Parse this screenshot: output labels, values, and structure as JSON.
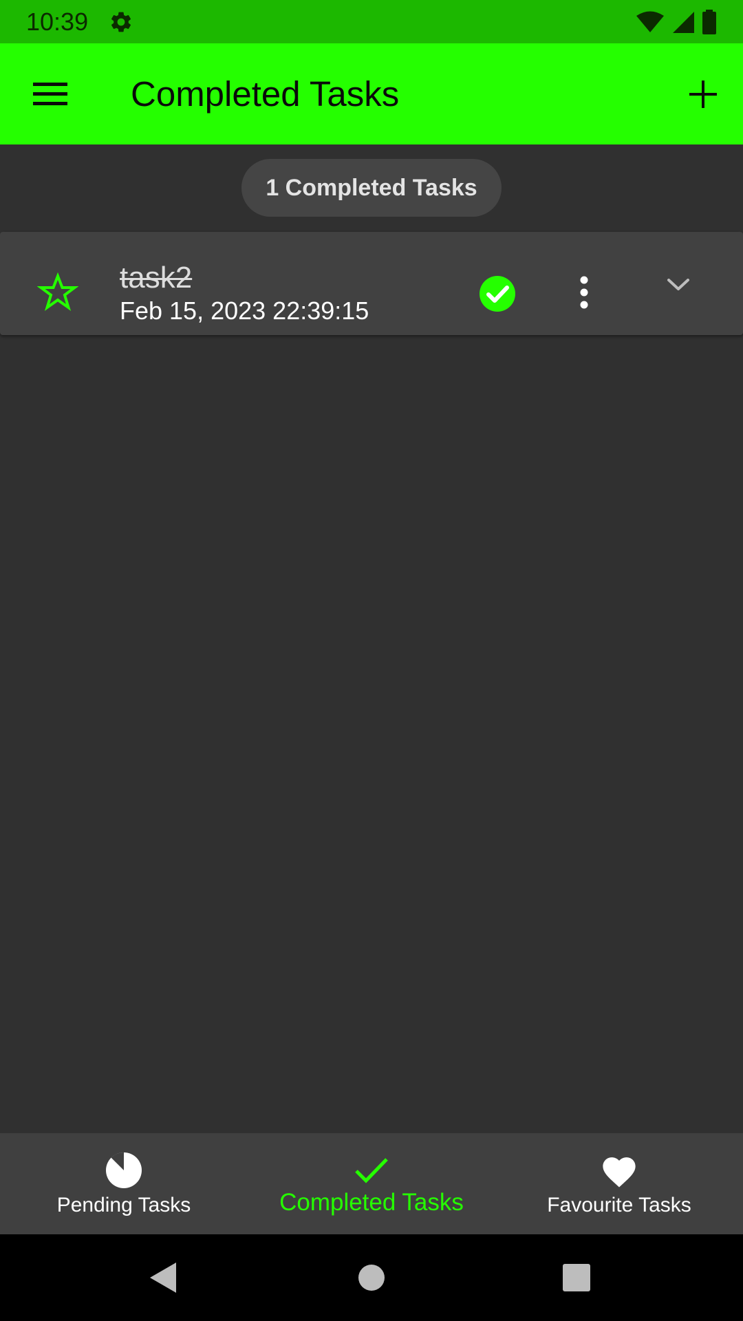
{
  "status_bar": {
    "time": "10:39",
    "icons": [
      "settings-icon",
      "wifi-icon",
      "signal-icon",
      "battery-icon"
    ]
  },
  "app_bar": {
    "title": "Completed Tasks",
    "menu_icon": "menu-icon",
    "add_icon": "add-icon"
  },
  "summary": {
    "count_label": "1 Completed Tasks"
  },
  "tasks": [
    {
      "title": "task2",
      "date": "Feb 15, 2023 22:39:15",
      "favourite": false,
      "completed": true
    }
  ],
  "bottom_nav": {
    "items": [
      {
        "label": "Pending Tasks",
        "icon": "pie-icon",
        "active": false
      },
      {
        "label": "Completed Tasks",
        "icon": "check-icon",
        "active": true
      },
      {
        "label": "Favourite Tasks",
        "icon": "heart-icon",
        "active": false
      }
    ]
  },
  "colors": {
    "status_bar": "#1cb800",
    "accent": "#25ff00",
    "background": "#303030",
    "card": "#414141",
    "chip": "#454545",
    "bottom_nav": "#404040"
  }
}
